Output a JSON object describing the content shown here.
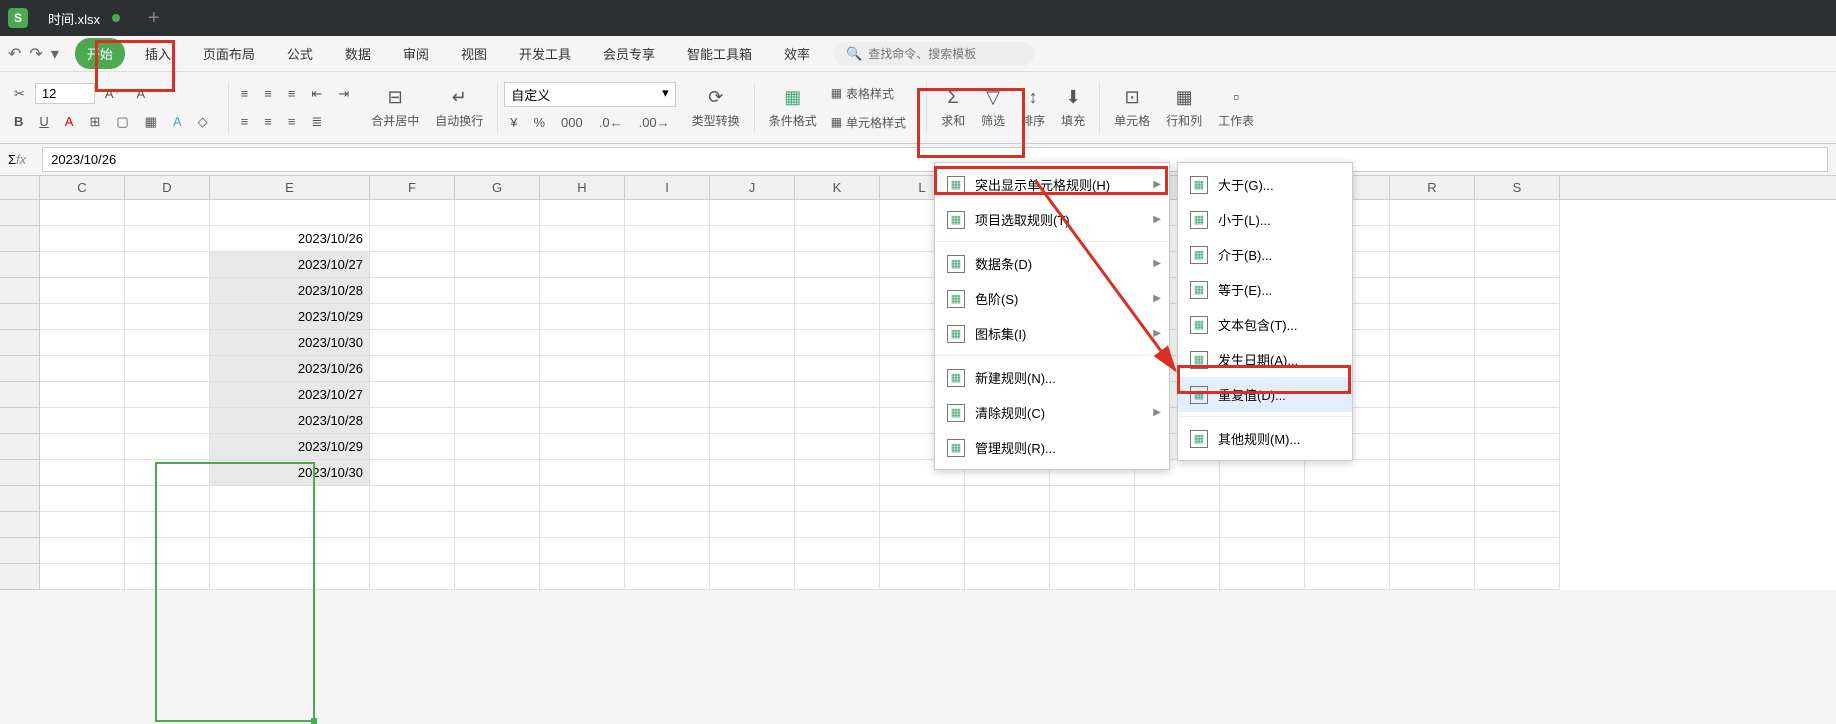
{
  "titlebar": {
    "app_icon_text": "S",
    "doc_name": "时间.xlsx"
  },
  "menubar": {
    "undo": "↶",
    "redo": "↷",
    "dropdown": "▾",
    "tabs": [
      "开始",
      "插入",
      "页面布局",
      "公式",
      "数据",
      "审阅",
      "视图",
      "开发工具",
      "会员专享",
      "智能工具箱",
      "效率"
    ],
    "active_tab_index": 0,
    "search_placeholder": "查找命令、搜索模板"
  },
  "ribbon": {
    "font_size": "12",
    "number_format": "自定义",
    "merge_center": "合并居中",
    "wrap_text": "自动换行",
    "type_convert": "类型转换",
    "cond_format": "条件格式",
    "table_style": "表格样式",
    "cell_style": "单元格样式",
    "sum": "求和",
    "filter": "筛选",
    "sort": "排序",
    "fill": "填充",
    "cell": "单元格",
    "row_col": "行和列",
    "worksheet": "工作表"
  },
  "formula_bar": {
    "fx": "fx",
    "value": "2023/10/26",
    "sum_icon": "Σ"
  },
  "columns": [
    "C",
    "D",
    "E",
    "F",
    "G",
    "H",
    "I",
    "J",
    "K",
    "L",
    "",
    "",
    "",
    "",
    "",
    "R",
    "S"
  ],
  "data_cells": [
    "2023/10/26",
    "2023/10/27",
    "2023/10/28",
    "2023/10/29",
    "2023/10/30",
    "2023/10/26",
    "2023/10/27",
    "2023/10/28",
    "2023/10/29",
    "2023/10/30"
  ],
  "cond_format_menu": {
    "items": [
      {
        "label": "突出显示单元格规则(H)",
        "has_sub": true
      },
      {
        "label": "项目选取规则(T)",
        "has_sub": true
      },
      {
        "sep": true
      },
      {
        "label": "数据条(D)",
        "has_sub": true
      },
      {
        "label": "色阶(S)",
        "has_sub": true
      },
      {
        "label": "图标集(I)",
        "has_sub": true
      },
      {
        "sep": true
      },
      {
        "label": "新建规则(N)...",
        "has_sub": false
      },
      {
        "label": "清除规则(C)",
        "has_sub": true
      },
      {
        "label": "管理规则(R)...",
        "has_sub": false
      }
    ]
  },
  "highlight_submenu": {
    "items": [
      {
        "label": "大于(G)..."
      },
      {
        "label": "小于(L)..."
      },
      {
        "label": "介于(B)..."
      },
      {
        "label": "等于(E)..."
      },
      {
        "label": "文本包含(T)..."
      },
      {
        "label": "发生日期(A)..."
      },
      {
        "label": "重复值(D)...",
        "highlighted": true
      },
      {
        "sep": true
      },
      {
        "label": "其他规则(M)..."
      }
    ]
  }
}
